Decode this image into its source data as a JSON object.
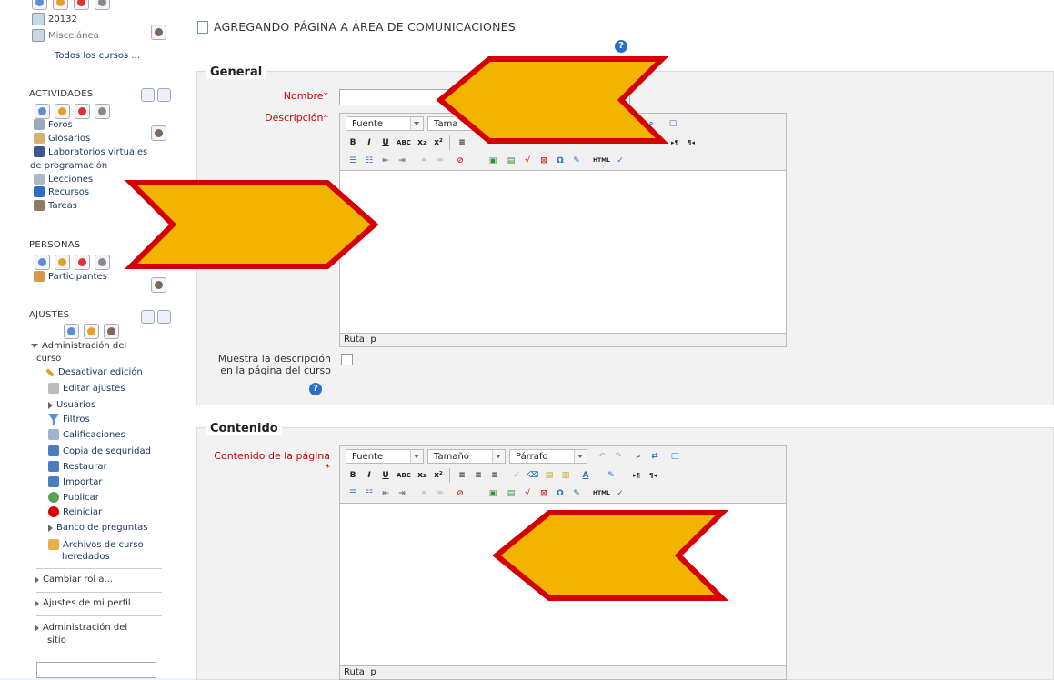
{
  "page": {
    "title": "AGREGANDO PÁGINA A ÁREA DE COMUNICACIONES"
  },
  "sidebar": {
    "courses": [
      {
        "label": "20132"
      },
      {
        "label": "Miscelánea"
      }
    ],
    "all_courses_link": "Todos los cursos ...",
    "actividades": {
      "title": "ACTIVIDADES",
      "items": [
        {
          "label": "Foros"
        },
        {
          "label": "Glosarios"
        },
        {
          "label": "Laboratorios virtuales"
        },
        {
          "label": "de programación"
        },
        {
          "label": "Lecciones"
        },
        {
          "label": "Recursos"
        },
        {
          "label": "Tareas"
        }
      ]
    },
    "personas": {
      "title": "PERSONAS",
      "items": [
        {
          "label": "Participantes"
        }
      ]
    },
    "ajustes": {
      "title": "AJUSTES",
      "admin_curso": "Administración del",
      "admin_curso2": "curso",
      "items": [
        {
          "label": "Desactivar edición"
        },
        {
          "label": "Editar ajustes"
        },
        {
          "label": "Usuarios"
        },
        {
          "label": "Filtros"
        },
        {
          "label": "Calificaciones"
        },
        {
          "label": "Copia de seguridad"
        },
        {
          "label": "Restaurar"
        },
        {
          "label": "Importar"
        },
        {
          "label": "Publicar"
        },
        {
          "label": "Reiniciar"
        },
        {
          "label": "Banco de preguntas"
        },
        {
          "label": "Archivos de curso"
        },
        {
          "label": "heredados"
        }
      ],
      "cambiar_rol": "Cambiar rol a...",
      "ajustes_perfil": "Ajustes de mi perfil",
      "admin_sitio": "Administración del",
      "admin_sitio2": "sitio"
    }
  },
  "form": {
    "general": {
      "legend": "General",
      "nombre_label": "Nombre",
      "required_mark": "*",
      "descripcion_label": "Descripción",
      "muestra_label_1": "Muestra la descripción",
      "muestra_label_2": "en la página del curso",
      "editor": {
        "fuente": "Fuente",
        "tamano": "Tama",
        "path": "Ruta: p"
      }
    },
    "contenido": {
      "legend": "Contenido",
      "contenido_label": "Contenido de la página",
      "required_mark": "*",
      "editor": {
        "fuente": "Fuente",
        "tamano": "Tamaño",
        "parrafo": "Párrafo",
        "path": "Ruta: p"
      }
    }
  },
  "toolbar": {
    "bold": "B",
    "italic": "I",
    "underline": "U",
    "strike": "ABC",
    "sub": "x₂",
    "sup": "x²",
    "omega": "Ω",
    "html": "HTML",
    "help_glyph": "?"
  },
  "colors": {
    "accent": "#2d6fc7",
    "required": "#cc0000",
    "arrow_fill": "#f3b400",
    "arrow_border": "#d40000"
  }
}
